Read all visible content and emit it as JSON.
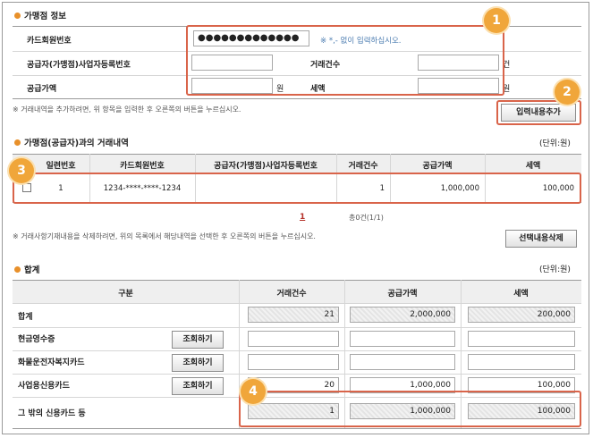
{
  "section1": {
    "title": "가맹점 정보",
    "card_label": "카드회원번호",
    "card_value": "●●●●●●●●●●●●●",
    "card_hint": "※ *,- 없이 입력하십시오.",
    "bizno_label": "공급자(가맹점)사업자등록번호",
    "count_label": "거래건수",
    "count_unit": "건",
    "amount_label": "공급가액",
    "amount_unit": "원",
    "tax_label": "세액",
    "tax_unit": "원",
    "note": "※ 거래내역을 추가하려면, 위 항목을 입력한 후 오른쪽의 버튼을 누르십시오.",
    "add_button": "입력내용추가"
  },
  "section2": {
    "title": "가맹점(공급자)과의 거래내역",
    "unit": "(단위:원)",
    "columns": [
      "일련번호",
      "카드회원번호",
      "공급자(가맹점)사업자등록번호",
      "거래건수",
      "공급가액",
      "세액"
    ],
    "row": {
      "seq": "1",
      "card": "1234-****-****-1234",
      "bizno": "",
      "count": "1",
      "amount": "1,000,000",
      "tax": "100,000"
    },
    "page": "1",
    "total": "총0건(1/1)",
    "note": "※ 거래사항기재내용을 삭제하려면, 위의 목록에서 해당내역을 선택한 후 오른쪽의 버튼을 누르십시오.",
    "delete_button": "선택내용삭제"
  },
  "section3": {
    "title": "합계",
    "unit": "(단위:원)",
    "columns": [
      "구분",
      "거래건수",
      "공급가액",
      "세액"
    ],
    "query_button": "조회하기",
    "rows": [
      {
        "label": "합계",
        "count": "21",
        "amount": "2,000,000",
        "tax": "200,000"
      },
      {
        "label": "현금영수증",
        "count": "",
        "amount": "",
        "tax": ""
      },
      {
        "label": "화물운전자복지카드",
        "count": "",
        "amount": "",
        "tax": ""
      },
      {
        "label": "사업용신용카드",
        "count": "20",
        "amount": "1,000,000",
        "tax": "100,000"
      },
      {
        "label": "그 밖의 신용카드 등",
        "count": "1",
        "amount": "1,000,000",
        "tax": "100,000"
      }
    ]
  },
  "badges": [
    "1",
    "2",
    "3",
    "4"
  ],
  "colors": {
    "accent": "#e8902a",
    "highlight": "#d9644a",
    "badge": "#f0a63a",
    "hint": "#4a7bb0"
  }
}
